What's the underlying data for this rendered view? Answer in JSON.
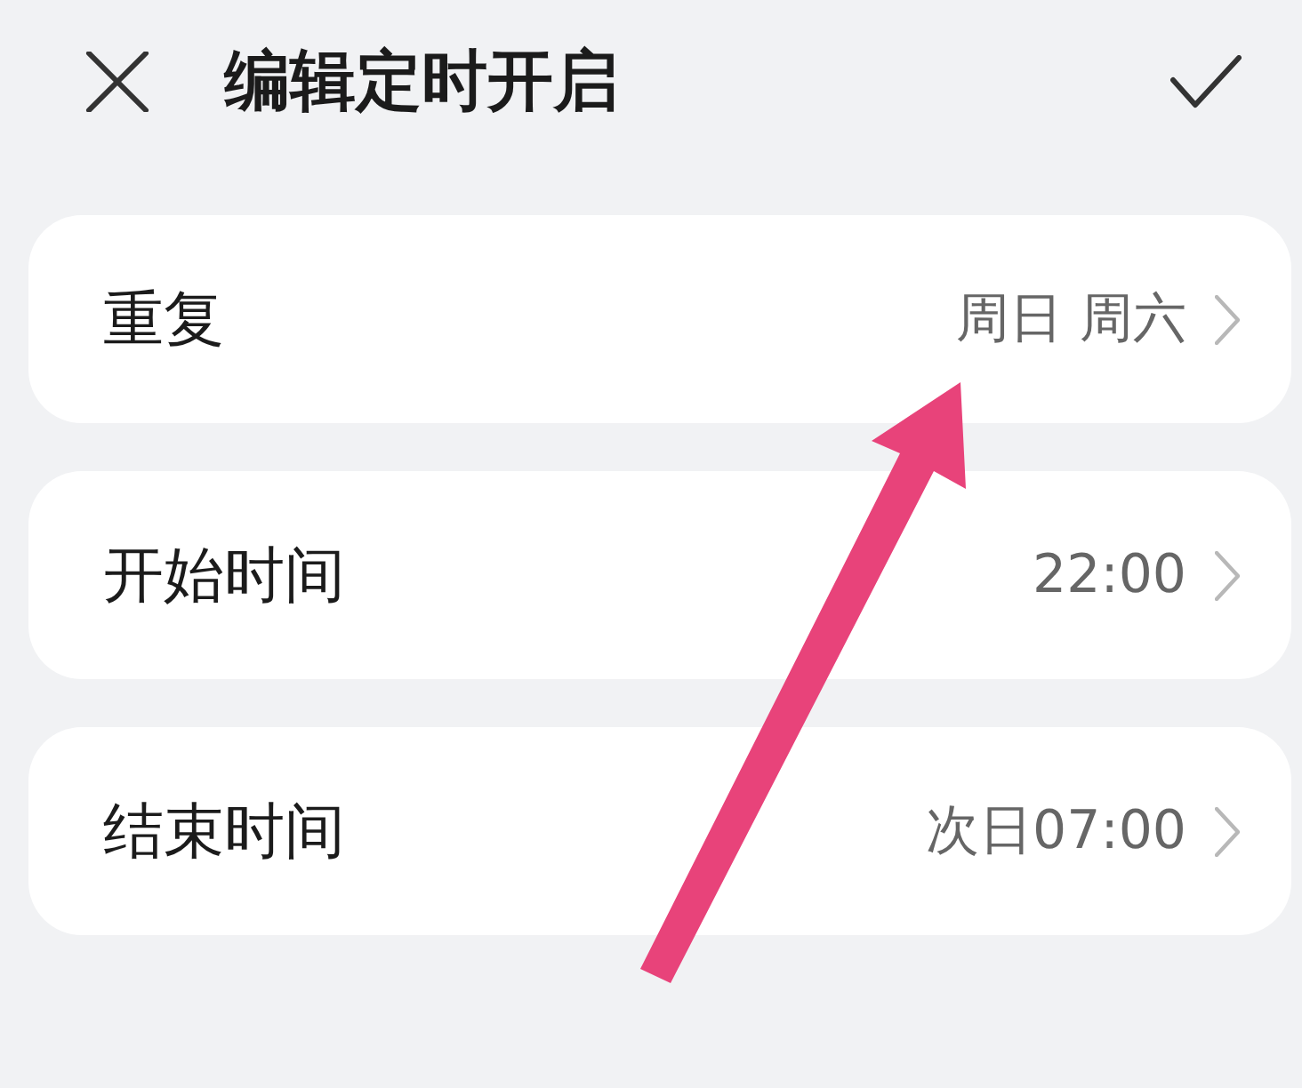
{
  "header": {
    "title": "编辑定时开启"
  },
  "rows": [
    {
      "label": "重复",
      "value": "周日 周六"
    },
    {
      "label": "开始时间",
      "value": "22:00"
    },
    {
      "label": "结束时间",
      "value": "次日07:00"
    }
  ]
}
